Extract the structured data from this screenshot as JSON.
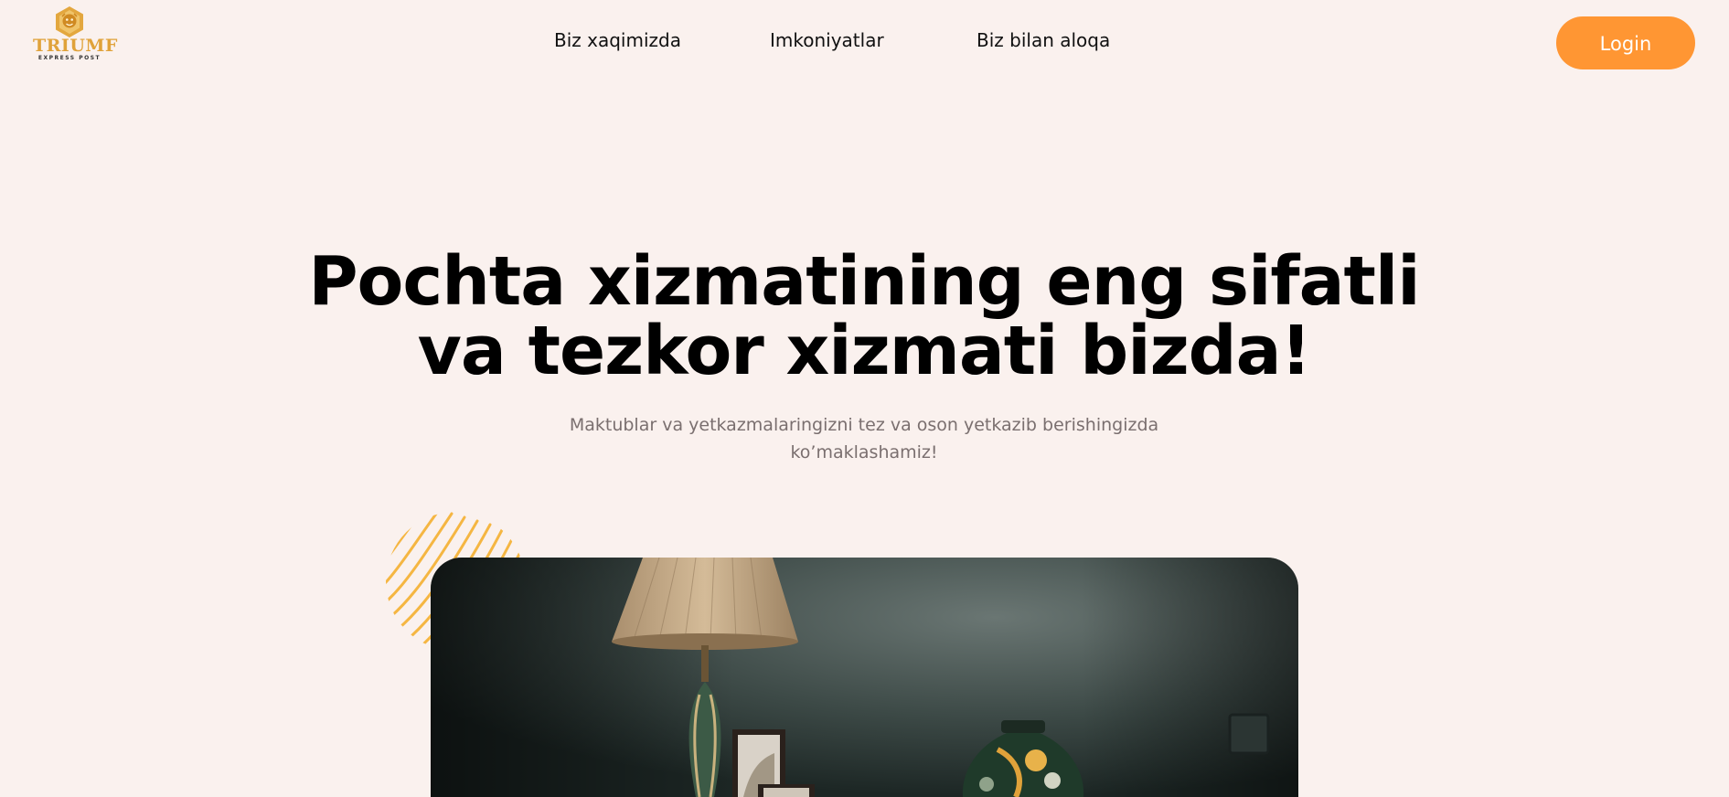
{
  "brand": {
    "name": "TRIUMF",
    "tagline": "EXPRESS POST",
    "color": "#e0a23a"
  },
  "nav": {
    "items": [
      {
        "label": "Biz xaqimizda"
      },
      {
        "label": "Imkoniyatlar"
      },
      {
        "label": "Biz bilan aloqa"
      }
    ]
  },
  "header": {
    "login_label": "Login",
    "login_color": "#ff9633"
  },
  "hero": {
    "title_line1": "Pochta xizmatining eng sifatli",
    "title_line2": "va tezkor xizmati bizda!",
    "subtitle_line1": "Maktublar va yetkazmalaringizni tez va oson yetkazib berishingizda",
    "subtitle_line2": "ko’maklashamiz!",
    "image_icon": "interior-photo"
  },
  "colors": {
    "background": "#faf1ee",
    "accent": "#ff9633",
    "decoration": "#f5b642"
  }
}
